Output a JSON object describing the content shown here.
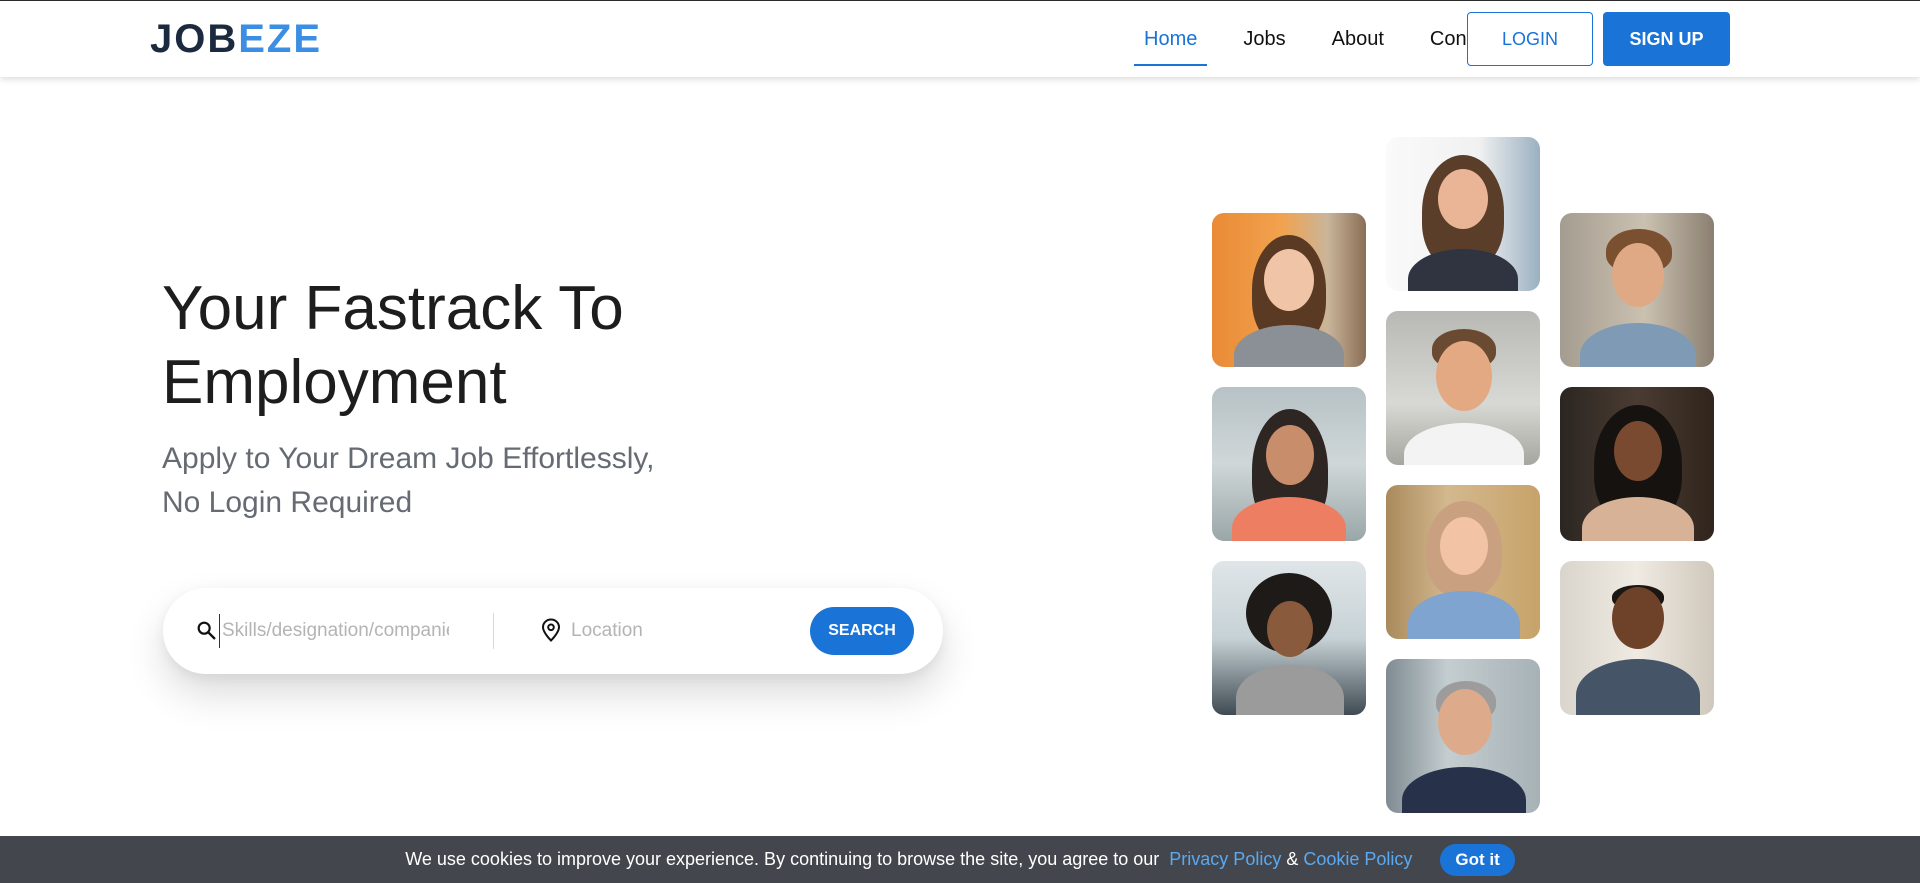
{
  "header": {
    "logo_part1": "JOB",
    "logo_part2": "EZE",
    "nav": [
      {
        "label": "Home",
        "active": true
      },
      {
        "label": "Jobs"
      },
      {
        "label": "About"
      },
      {
        "label": "Contact"
      }
    ],
    "login_label": "LOGIN",
    "signup_label": "SIGN UP"
  },
  "hero": {
    "title_line1": "Your Fastrack To",
    "title_line2": "Employment",
    "subtitle_line1": "Apply to Your Dream Job Effortlessly,",
    "subtitle_line2": "No Login Required"
  },
  "search": {
    "skills_placeholder": "Skills/designation/companies",
    "location_placeholder": "Location",
    "button_label": "SEARCH"
  },
  "cookie": {
    "message": "We use cookies to improve your experience. By continuing to browse the site, you agree to our",
    "privacy_label": "Privacy Policy",
    "amp": "&",
    "cookie_label": "Cookie Policy",
    "button_label": "Got it"
  },
  "colors": {
    "primary": "#1a73d6",
    "logo_dark": "#1b2a3e",
    "logo_light": "#3b8ee3",
    "banner_bg": "#43474d"
  }
}
